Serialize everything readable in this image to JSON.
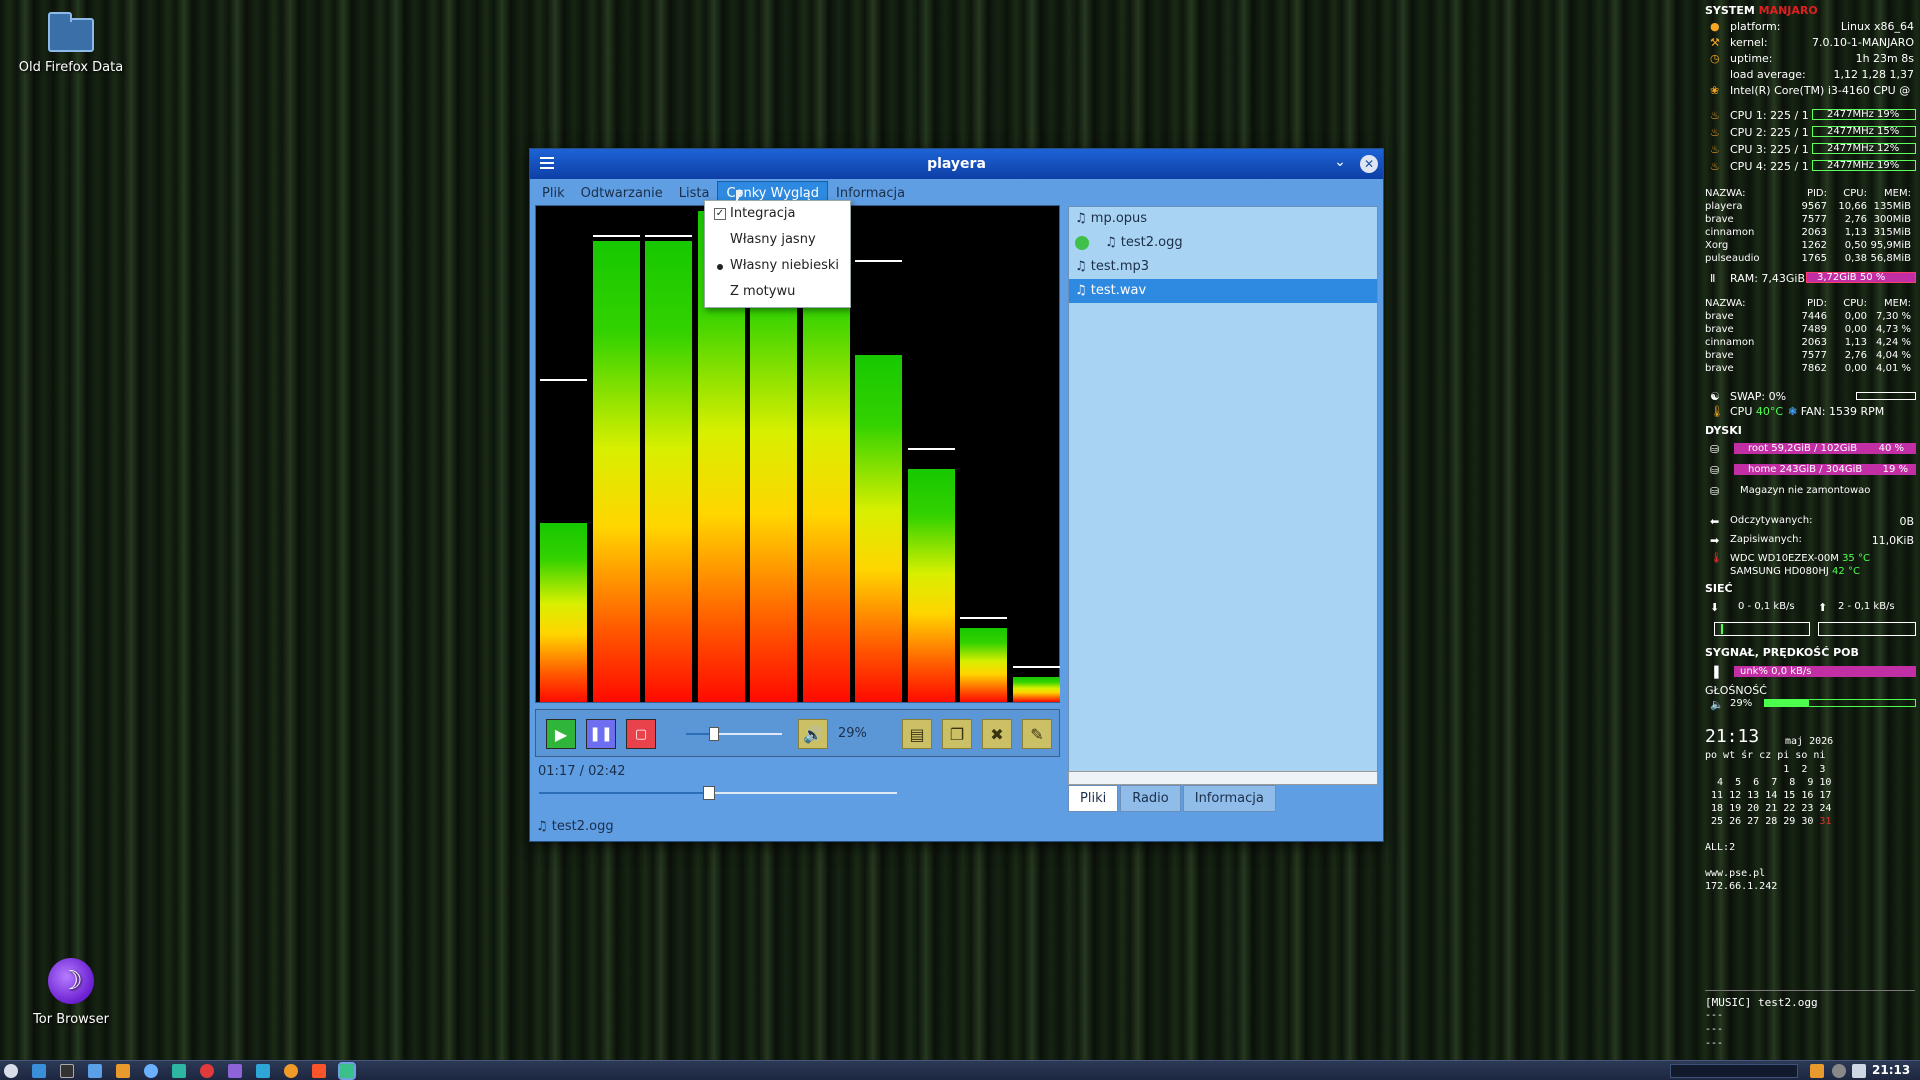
{
  "desktop": {
    "icon1": "Old Firefox Data",
    "icon2": "Tor Browser"
  },
  "window": {
    "title": "playera"
  },
  "menu": [
    "Plik",
    "Odtwarzanie",
    "Lista",
    "Conky Wygląd",
    "Informacja"
  ],
  "dropdown": {
    "items": [
      "Integracja",
      "Własny jasny",
      "Własny niebieski",
      "Z motywu"
    ],
    "checked": "Integracja",
    "selected": "Własny niebieski"
  },
  "visualizer": {
    "levels": [
      0.36,
      0.93,
      0.93,
      0.99,
      0.99,
      0.99,
      0.7,
      0.47,
      0.15,
      0.05
    ],
    "peaks": [
      0.64,
      0.93,
      0.93,
      null,
      null,
      null,
      0.88,
      0.5,
      0.16,
      0.06
    ]
  },
  "controls": {
    "volume_text": "29%",
    "volume": 0.29
  },
  "playback": {
    "time": "01:17 / 02:42",
    "progress": 0.475,
    "now_playing": "test2.ogg"
  },
  "playlist": [
    {
      "name": "mp.opus"
    },
    {
      "name": "test2.ogg",
      "playing": true
    },
    {
      "name": "test.mp3"
    },
    {
      "name": "test.wav",
      "selected": true
    }
  ],
  "tabs": [
    "Pliki",
    "Radio",
    "Informacja"
  ],
  "conky": {
    "system": "SYSTEM",
    "distro": "MANJARO",
    "platform_l": "platform:",
    "platform": "Linux x86_64",
    "kernel_l": "kernel:",
    "kernel": "7.0.10-1-MANJARO",
    "uptime_l": "uptime:",
    "uptime": "1h 23m 8s",
    "load_l": "load average:",
    "load": "1,12 1,28 1,37",
    "cpu_model": "Intel(R) Core(TM) i3-4160 CPU @",
    "cpus": [
      {
        "l": "CPU 1: 225 / 1",
        "v": "2477MHz  19%"
      },
      {
        "l": "CPU 2: 225 / 1",
        "v": "2477MHz  15%"
      },
      {
        "l": "CPU 3: 225 / 1",
        "v": "2477MHz  12%"
      },
      {
        "l": "CPU 4: 225 / 1",
        "v": "2477MHz  19%"
      }
    ],
    "proc_hdr": [
      "NAZWA:",
      "PID:",
      "CPU:",
      "MEM:"
    ],
    "procs_mem": [
      [
        "playera",
        "9567",
        "10,66",
        "135MiB"
      ],
      [
        "brave",
        "7577",
        "2,76",
        "300MiB"
      ],
      [
        "cinnamon",
        "2063",
        "1,13",
        "315MiB"
      ],
      [
        "Xorg",
        "1262",
        "0,50",
        "95,9MiB"
      ],
      [
        "pulseaudio",
        "1765",
        "0,38",
        "56,8MiB"
      ]
    ],
    "ram_l": "RAM: 7,43GiB",
    "ram_v": "3,72GiB  50 %",
    "procs_cpu": [
      [
        "brave",
        "7446",
        "0,00",
        "7,30 %"
      ],
      [
        "brave",
        "7489",
        "0,00",
        "4,73 %"
      ],
      [
        "cinnamon",
        "2063",
        "1,13",
        "4,24 %"
      ],
      [
        "brave",
        "7577",
        "2,76",
        "4,04 %"
      ],
      [
        "brave",
        "7862",
        "0,00",
        "4,01 %"
      ]
    ],
    "swap": "SWAP: 0%",
    "cpu_temp_l": "CPU",
    "cpu_temp": "40°C",
    "fan": "FAN: 1539 RPM",
    "disks_hdr": "DYSKI",
    "root": "root  59,2GiB / 102GiB",
    "root_p": "40 %",
    "home": "home  243GiB / 304GiB",
    "home_p": "19 %",
    "magazyn": "Magazyn nie zamontowao",
    "read_l": "Odczytywanych:",
    "read": "0B",
    "write_l": "Zapisiwanych:",
    "write": "11,0KiB",
    "hdd1": "WDC WD10EZEX-00M",
    "hdd1_t": "35 °C",
    "hdd2": "SAMSUNG HD080HJ",
    "hdd2_t": "42 °C",
    "net_hdr": "SIEĆ",
    "down": "0 - 0,1 kB/s",
    "up": "2 - 0,1 kB/s",
    "signal_hdr": "SYGNAŁ, PRĘDKOŚĆ POB",
    "signal": "unk%  0,0 kB/s",
    "vol_hdr": "GŁOŚNOŚĆ",
    "vol": "29%",
    "clock": "21:13",
    "month": "maj 2026",
    "weekdays": "po wt śr cz pi so ni",
    "cal": [
      "             1  2  3",
      "  4  5  6  7  8  9 10",
      " 11 12 13 14 15 16 17",
      " 18 19 20 21 22 23 24",
      " 25 26 27 28 29 30 31"
    ],
    "all": "ALL:2",
    "site": "www.pse.pl",
    "ip": "172.66.1.242",
    "music": "[MUSIC] test2.ogg",
    "dash1": "---",
    "dash2": "---",
    "dash3": "---"
  },
  "taskbar": {
    "time": "21:13"
  },
  "colors": {
    "accent": "#2e8ae0",
    "title": "#1d63d6",
    "panel": "#5f9ee3",
    "playlist": "#a9d3f2",
    "magenta": "#c22fa5"
  }
}
